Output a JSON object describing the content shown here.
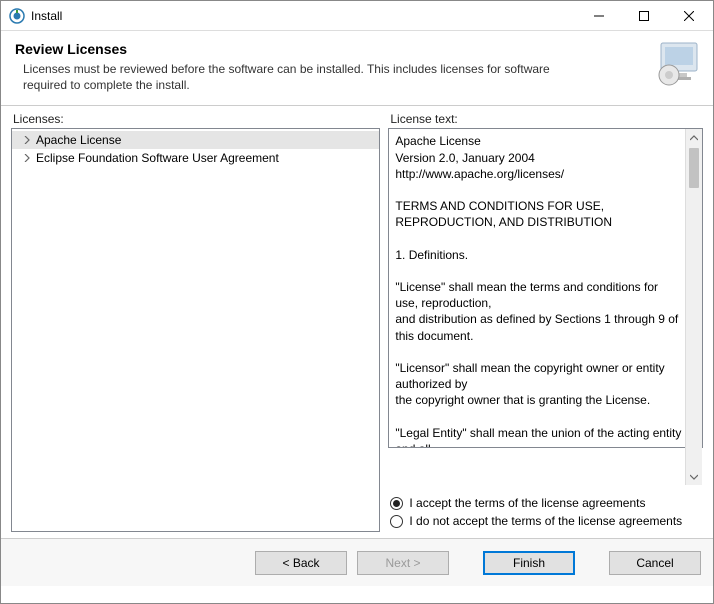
{
  "window": {
    "title": "Install"
  },
  "header": {
    "title": "Review Licenses",
    "description": "Licenses must be reviewed before the software can be installed.  This includes licenses for software required to complete the install."
  },
  "licenses": {
    "label": "Licenses:",
    "items": [
      {
        "label": "Apache License",
        "selected": true
      },
      {
        "label": "Eclipse Foundation Software User Agreement",
        "selected": false
      }
    ]
  },
  "license_text": {
    "label": "License text:",
    "body": "Apache License\nVersion 2.0, January 2004\nhttp://www.apache.org/licenses/\n\nTERMS AND CONDITIONS FOR USE, REPRODUCTION, AND DISTRIBUTION\n\n1. Definitions.\n\n\"License\" shall mean the terms and conditions for use, reproduction,\nand distribution as defined by Sections 1 through 9 of this document.\n\n\"Licensor\" shall mean the copyright owner or entity authorized by\nthe copyright owner that is granting the License.\n\n\"Legal Entity\" shall mean the union of the acting entity and all\nother entities that control, are controlled by, or are"
  },
  "agreement": {
    "accept_label": "I accept the terms of the license agreements",
    "reject_label": "I do not accept the terms of the license agreements",
    "selected": "accept"
  },
  "buttons": {
    "back": "< Back",
    "next": "Next >",
    "finish": "Finish",
    "cancel": "Cancel"
  }
}
